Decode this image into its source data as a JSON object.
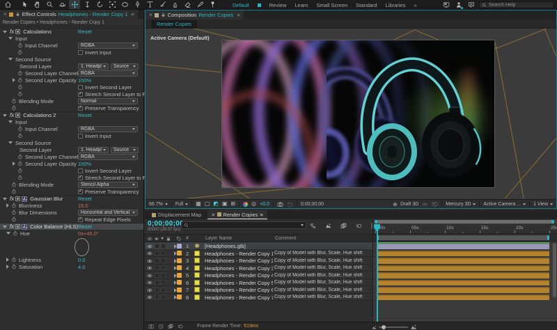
{
  "top_bar": {
    "tools": [
      {
        "name": "home",
        "selected": false
      },
      {
        "name": "selection",
        "selected": false
      },
      {
        "name": "hand",
        "selected": false
      },
      {
        "name": "zoom",
        "selected": false
      },
      {
        "name": "orbit-camera",
        "selected": false
      },
      {
        "name": "pan-camera",
        "selected": true
      },
      {
        "name": "dolly-camera",
        "selected": false
      },
      {
        "name": "rotation",
        "selected": false
      },
      {
        "name": "pan-behind",
        "selected": false
      },
      {
        "name": "shape",
        "selected": false
      },
      {
        "name": "pen",
        "selected": false
      },
      {
        "name": "type",
        "selected": false
      },
      {
        "name": "brush",
        "selected": false
      },
      {
        "name": "clone-stamp",
        "selected": false
      },
      {
        "name": "eraser",
        "selected": false
      },
      {
        "name": "roto-brush",
        "selected": false
      },
      {
        "name": "puppet-pin",
        "selected": false
      }
    ],
    "workspaces": [
      {
        "label": "Default",
        "active": true
      },
      {
        "label": "Review",
        "active": false
      },
      {
        "label": "Learn",
        "active": false
      },
      {
        "label": "Small Screen",
        "active": false
      },
      {
        "label": "Standard",
        "active": false
      },
      {
        "label": "Libraries",
        "active": false
      }
    ],
    "overflow_chevron": "»",
    "search_placeholder": "Search Help"
  },
  "effect_controls": {
    "close": "×",
    "tab_title": "Effect Controls",
    "tab_target": "Headphones - Render Copy 1",
    "breadcrumb": "Render Copies • Headphones - Render Copy 1",
    "rows": [
      {
        "t": "header",
        "label": "Calculations",
        "reset": "Reset"
      },
      {
        "t": "group",
        "label": "Input"
      },
      {
        "t": "dropdown",
        "sw": 1,
        "label": "Input Channel",
        "value": "RGBA"
      },
      {
        "t": "check",
        "sw": 1,
        "label": "Invert Input",
        "checked": false
      },
      {
        "t": "group",
        "label": "Second Source"
      },
      {
        "t": "dropdown2",
        "ind": 1,
        "label": "Second Layer",
        "value": "1. Headpl",
        "value2": "Source"
      },
      {
        "t": "dropdown",
        "sw": 1,
        "label": "Second Layer Channel",
        "value": "RGBA"
      },
      {
        "t": "value",
        "tw": 1,
        "sw": 1,
        "label": "Second Layer Opacity",
        "value": "100%",
        "vcolor": "cyan"
      },
      {
        "t": "check",
        "sw": 1,
        "label": "Invert Second Layer",
        "checked": false
      },
      {
        "t": "check",
        "sw": 1,
        "label": "Stretch Second Layer to F",
        "checked": true
      },
      {
        "t": "dropdown",
        "sw": 1,
        "ind": 1,
        "label": "Blending Mode",
        "value": "Normal"
      },
      {
        "t": "check",
        "sw": 1,
        "ind": 1,
        "label": "Preserve Transparency",
        "checked": true
      },
      {
        "t": "header",
        "label": "Calculations 2",
        "reset": "Reset"
      },
      {
        "t": "group",
        "label": "Input"
      },
      {
        "t": "dropdown",
        "sw": 1,
        "label": "Input Channel",
        "value": "RGBA"
      },
      {
        "t": "check",
        "sw": 1,
        "label": "Invert Input",
        "checked": false
      },
      {
        "t": "group",
        "label": "Second Source"
      },
      {
        "t": "dropdown2",
        "ind": 1,
        "label": "Second Layer",
        "value": "1. Headpl",
        "value2": "Source"
      },
      {
        "t": "dropdown",
        "sw": 1,
        "label": "Second Layer Channel",
        "value": "RGBA"
      },
      {
        "t": "value",
        "tw": 1,
        "sw": 1,
        "label": "Second Layer Opacity",
        "value": "100%",
        "vcolor": "cyan"
      },
      {
        "t": "check",
        "sw": 1,
        "label": "Invert Second Layer",
        "checked": false
      },
      {
        "t": "check",
        "sw": 1,
        "label": "Stretch Second Layer to F",
        "checked": true
      },
      {
        "t": "dropdown",
        "sw": 1,
        "ind": 1,
        "label": "Blending Mode",
        "value": "Stencil Alpha"
      },
      {
        "t": "check",
        "sw": 1,
        "ind": 1,
        "label": "Preserve Transparency",
        "checked": true
      },
      {
        "t": "header",
        "eff": 1,
        "label": "Gaussian Blur",
        "reset": "Reset"
      },
      {
        "t": "value",
        "tw": 1,
        "sw": 1,
        "ind": 1,
        "label": "Blurriness",
        "value": "15.0",
        "vcolor": "red"
      },
      {
        "t": "dropdown",
        "sw": 1,
        "ind": 1,
        "label": "Blur Dimensions",
        "value": "Horizontal and Vertical"
      },
      {
        "t": "check",
        "sw": 1,
        "ind": 1,
        "label": "Repeat Edge Pixels",
        "checked": true
      },
      {
        "t": "header",
        "eff": 1,
        "sel": 1,
        "label": "Color Balance (HLS)",
        "reset": "Reset"
      },
      {
        "t": "value",
        "tw": "open",
        "sw": 1,
        "ind": 1,
        "label": "Hue",
        "value": "0x+45.0°",
        "vcolor": "red"
      },
      {
        "t": "dial",
        "angle": 45
      },
      {
        "t": "value",
        "tw": 1,
        "sw": 1,
        "ind": 1,
        "label": "Lightness",
        "value": "0.0",
        "vcolor": "cyan"
      },
      {
        "t": "value",
        "tw": 1,
        "sw": 1,
        "ind": 1,
        "label": "Saturation",
        "value": "4.0",
        "vcolor": "cyan"
      }
    ]
  },
  "composition": {
    "close": "×",
    "tab_title": "Composition",
    "tab_target": "Render Copies",
    "viewer_tab": "Render Copies",
    "camera_label": "Active Camera (Default)",
    "toolbar": {
      "zoom": "66.7%",
      "resolution": "Full",
      "exposure": "+0.0",
      "timecode": "0;00;00;00",
      "draft": "Draft 3D",
      "renderer": "Mercury 3D",
      "camera": "Active Camera ...",
      "views": "1 View"
    }
  },
  "timeline": {
    "tabs": [
      {
        "label": "Displacement Map",
        "active": false
      },
      {
        "label": "Render Copies",
        "active": true
      }
    ],
    "timecode": "0;00;00;00",
    "frame_info": "00000 (29.97 fps)",
    "columns": {
      "number": "#",
      "layer_name": "Layer Name",
      "comment": "Comment"
    },
    "layers": [
      {
        "num": "1",
        "name": "[Headphones.glb]",
        "comment": "",
        "label_color": "#a9a7d4",
        "icon": "model",
        "bar_color": "#9a99b5",
        "selected": true
      },
      {
        "num": "2",
        "name": "Headphones - Render Copy 1",
        "comment": "Copy of Model with Blur, Scale, Hue shift",
        "label_color": "#e6a53c",
        "icon": "solid",
        "bar_color": "#b5822e",
        "selected": false
      },
      {
        "num": "3",
        "name": "Headphones - Render Copy 2",
        "comment": "Copy of Model with Blur, Scale, Hue shift",
        "label_color": "#e6a53c",
        "icon": "solid",
        "bar_color": "#b5822e",
        "selected": false
      },
      {
        "num": "4",
        "name": "Headphones - Render Copy 3",
        "comment": "Copy of Model with Blur, Scale, Hue shift",
        "label_color": "#e6a53c",
        "icon": "solid",
        "bar_color": "#b5822e",
        "selected": false
      },
      {
        "num": "5",
        "name": "Headphones - Render Copy 4",
        "comment": "Copy of Model with Blur, Scale, Hue shift",
        "label_color": "#e6a53c",
        "icon": "solid",
        "bar_color": "#b5822e",
        "selected": false
      },
      {
        "num": "6",
        "name": "Headphones - Render Copy 5",
        "comment": "Copy of Model with Blur, Scale, Hue shift",
        "label_color": "#e6a53c",
        "icon": "solid",
        "bar_color": "#b5822e",
        "selected": false
      },
      {
        "num": "7",
        "name": "Headphones - Render Copy 6",
        "comment": "Copy of Model with Blur, Scale, Hue shift",
        "label_color": "#e6a53c",
        "icon": "solid",
        "bar_color": "#b5822e",
        "selected": false
      },
      {
        "num": "8",
        "name": "Headphones - Render Copy 7",
        "comment": "Copy of Model with Blur, Scale, Hue shift",
        "label_color": "#e6a53c",
        "icon": "solid",
        "bar_color": "#b5822e",
        "selected": false
      }
    ],
    "ruler_ticks": [
      ":00s",
      "05s",
      "10s",
      "15s",
      "20s",
      "25s"
    ],
    "footer": {
      "render_time_label": "Frame Render Time:",
      "render_time_value": "619ms"
    }
  },
  "colors": {
    "accent": "#2ab5c4",
    "value_cyan": "#41b9c6",
    "value_red": "#cf6a5d",
    "label_orange": "#e6a53c",
    "bar_orange": "#b5822e",
    "cache_green": "#35d13e"
  }
}
